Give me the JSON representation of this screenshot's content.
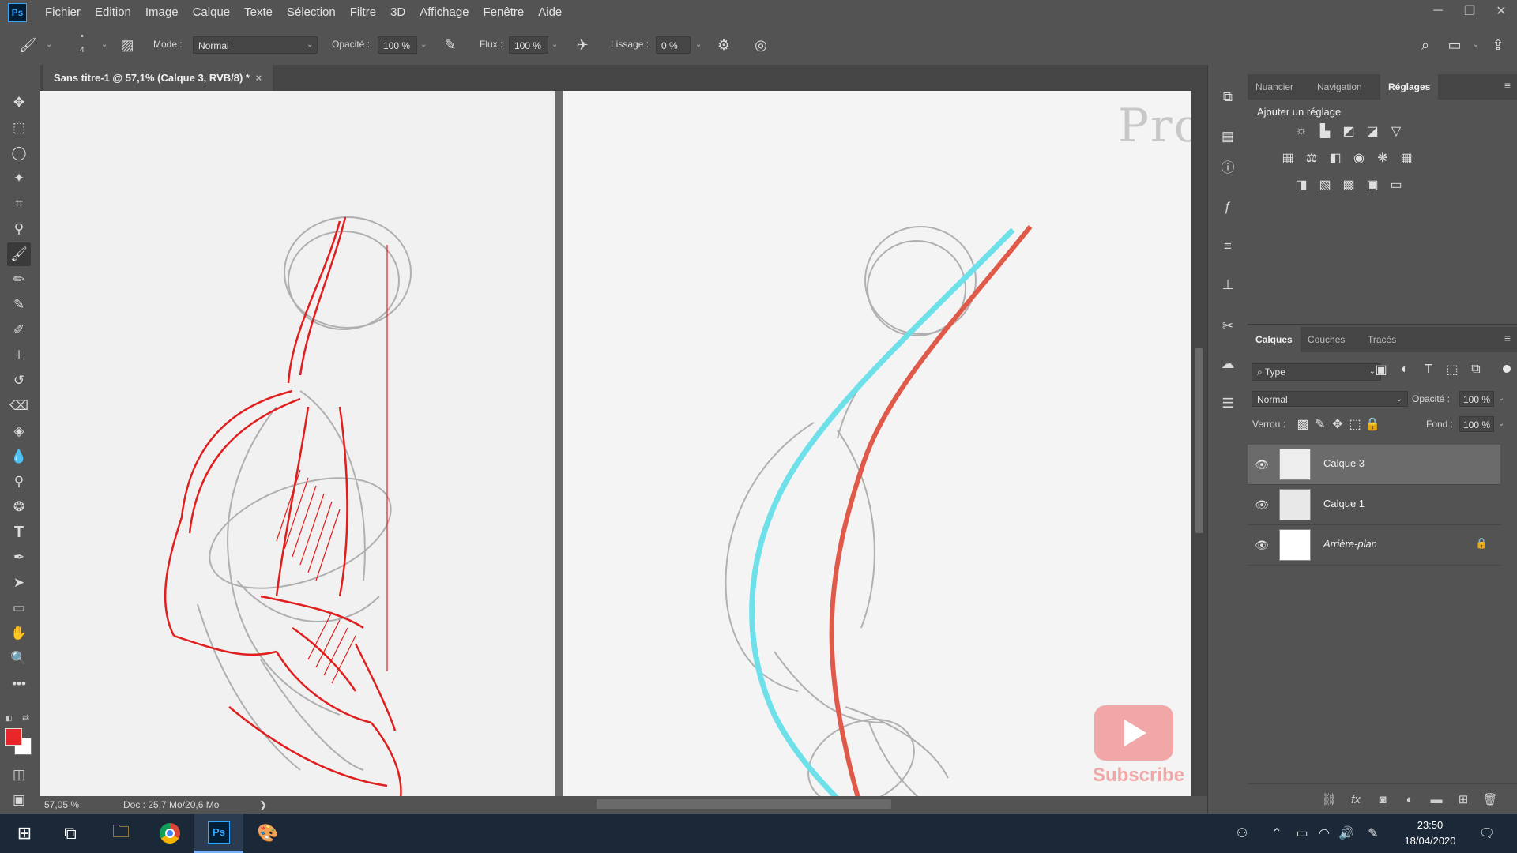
{
  "app": {
    "logo": "Ps"
  },
  "menu": [
    "Fichier",
    "Edition",
    "Image",
    "Calque",
    "Texte",
    "Sélection",
    "Filtre",
    "3D",
    "Affichage",
    "Fenêtre",
    "Aide"
  ],
  "options": {
    "brush_size": "4",
    "mode_label": "Mode :",
    "mode_value": "Normal",
    "opacity_label": "Opacité :",
    "opacity_value": "100 %",
    "flow_label": "Flux :",
    "flow_value": "100 %",
    "smoothing_label": "Lissage :",
    "smoothing_value": "0 %"
  },
  "document": {
    "tab_title": "Sans titre-1 @ 57,1% (Calque 3, RVB/8) *",
    "close": "×"
  },
  "canvas": {
    "watermark": "Proko",
    "subscribe": "Subscribe"
  },
  "status": {
    "zoom": "57,05 %",
    "doc_info": "Doc : 25,7 Mo/20,6 Mo",
    "arrow": "❯"
  },
  "panels": {
    "top_tabs": [
      "Nuancier",
      "Navigation",
      "Réglages"
    ],
    "adjustments_title": "Ajouter un réglage",
    "layers_tabs": [
      "Calques",
      "Couches",
      "Tracés"
    ],
    "filter_kind": "Type",
    "blend_mode": "Normal",
    "opacity_label": "Opacité :",
    "opacity_value": "100 %",
    "lock_label": "Verrou :",
    "fill_label": "Fond :",
    "fill_value": "100 %",
    "layers": [
      {
        "name": "Calque 3",
        "selected": true
      },
      {
        "name": "Calque 1",
        "selected": false
      },
      {
        "name": "Arrière-plan",
        "selected": false,
        "locked": true
      }
    ]
  },
  "colors": {
    "foreground": "#e8262a",
    "background": "#ffffff",
    "red_line": "#e05a4a",
    "cyan_line": "#6ee0ea"
  },
  "taskbar": {
    "time": "23:50",
    "date": "18/04/2020"
  }
}
